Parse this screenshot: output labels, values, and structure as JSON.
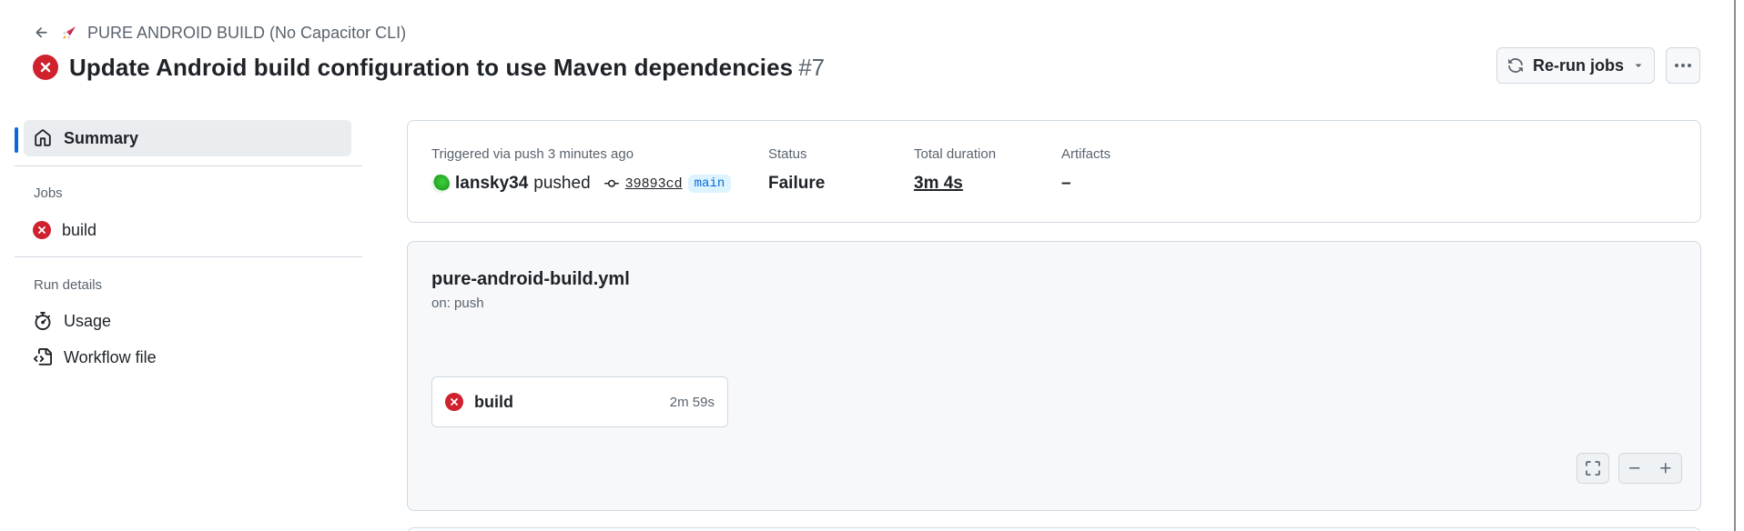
{
  "header": {
    "workflow_name": "🚀 PURE ANDROID BUILD (No Capacitor CLI)",
    "workflow_label": "PURE ANDROID BUILD (No Capacitor CLI)",
    "run_title": "Update Android build configuration to use Maven dependencies",
    "run_number": "#7",
    "rerun_label": "Re-run jobs",
    "icons": {
      "back": "arrow-left-icon",
      "status": "x-circle-fill-icon",
      "rerun": "sync-icon",
      "dropdown": "triangle-down-icon",
      "more": "kebab-horizontal-icon"
    }
  },
  "sidebar": {
    "summary_label": "Summary",
    "jobs_heading": "Jobs",
    "jobs": [
      {
        "label": "build",
        "status": "failure"
      }
    ],
    "run_details_heading": "Run details",
    "run_details": [
      {
        "label": "Usage",
        "icon": "stopwatch-icon"
      },
      {
        "label": "Workflow file",
        "icon": "file-code-icon"
      }
    ]
  },
  "summary": {
    "trigger_label": "Triggered via push 3 minutes ago",
    "actor": "lansky34",
    "action": "pushed",
    "commit_sha": "39893cd",
    "branch": "main",
    "status_label": "Status",
    "status_value": "Failure",
    "duration_label": "Total duration",
    "duration_value": "3m 4s",
    "artifacts_label": "Artifacts",
    "artifacts_value": "–"
  },
  "graph": {
    "workflow_file": "pure-android-build.yml",
    "trigger": "on: push",
    "jobs": [
      {
        "name": "build",
        "duration": "2m 59s",
        "status": "failure"
      }
    ],
    "controls": [
      "screen-full-icon",
      "dash-icon",
      "plus-icon"
    ]
  },
  "colors": {
    "failure": "#cf222e",
    "accent": "#0969da",
    "muted_text": "#59636e",
    "border": "#d1d9e0",
    "canvas_subtle": "#f6f8fa"
  }
}
